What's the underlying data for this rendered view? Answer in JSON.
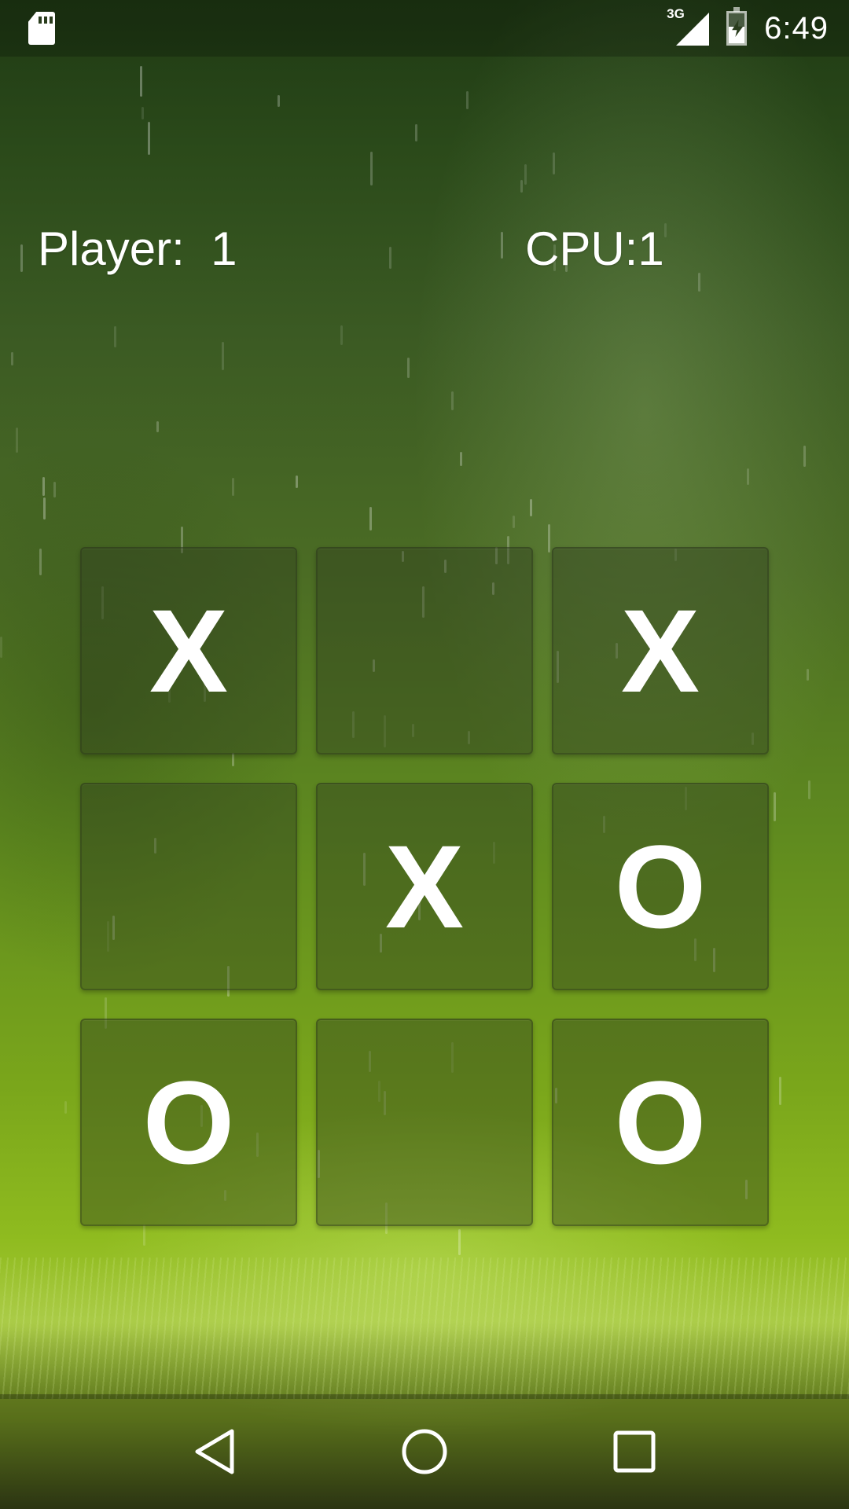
{
  "status_bar": {
    "network_type": "3G",
    "time": "6:49",
    "battery_level_fraction": 0.55,
    "icons": [
      "sd-card-icon",
      "cell-signal-icon",
      "battery-charging-icon"
    ]
  },
  "scoreboard": {
    "player_text": "Player:  1",
    "cpu_text": "CPU:1"
  },
  "board": {
    "cells": [
      {
        "row": 1,
        "col": 1,
        "mark": "X"
      },
      {
        "row": 1,
        "col": 2,
        "mark": ""
      },
      {
        "row": 1,
        "col": 3,
        "mark": "X"
      },
      {
        "row": 2,
        "col": 1,
        "mark": ""
      },
      {
        "row": 2,
        "col": 2,
        "mark": "X"
      },
      {
        "row": 2,
        "col": 3,
        "mark": "O"
      },
      {
        "row": 3,
        "col": 1,
        "mark": "O"
      },
      {
        "row": 3,
        "col": 2,
        "mark": ""
      },
      {
        "row": 3,
        "col": 3,
        "mark": "O"
      }
    ]
  },
  "nav_bar": {
    "buttons": [
      "back-icon",
      "home-icon",
      "recents-icon"
    ]
  },
  "colors": {
    "text": "#ffffff",
    "cell_bg": "#2d3c1e",
    "bg_top": "#1f3a14",
    "bg_mid": "#7aa61b"
  }
}
